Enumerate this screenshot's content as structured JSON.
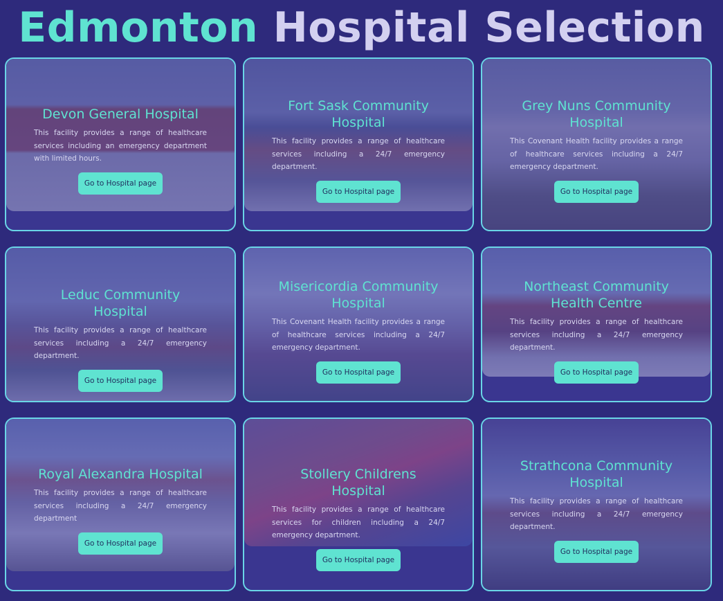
{
  "header": {
    "title_accent": "Edmonton",
    "title_rest": "Hospital Selection"
  },
  "hospitals": [
    {
      "name": "Devon General Hospital",
      "description": "This facility provides a range of healthcare services including an emergency department with limited hours.",
      "button_label": "Go to Hospital page"
    },
    {
      "name": "Fort Sask Community Hospital",
      "description": "This facility provides a range of healthcare services including a 24/7 emergency department.",
      "button_label": "Go to Hospital page"
    },
    {
      "name": "Grey Nuns Community Hospital",
      "description": "This Covenant Health facility provides a range of healthcare services including a 24/7 emergency department.",
      "button_label": "Go to Hospital page"
    },
    {
      "name": "Leduc Community Hospital",
      "description": "This facility provides a range of healthcare services including a 24/7 emergency department.",
      "button_label": "Go to Hospital page"
    },
    {
      "name": "Misericordia Community Hospital",
      "description": "This Covenant Health facility provides a range of healthcare services including a 24/7 emergency department.",
      "button_label": "Go to Hospital page"
    },
    {
      "name": "Northeast Community Health Centre",
      "description": "This facility provides a range of healthcare services including a 24/7 emergency department.",
      "button_label": "Go to Hospital page"
    },
    {
      "name": "Royal Alexandra Hospital",
      "description": "This facility provides a range of healthcare services including a 24/7 emergency department",
      "button_label": "Go to Hospital page"
    },
    {
      "name": "Stollery Childrens Hospital",
      "description": "This facility provides a range of healthcare services for children including a 24/7 emergency department.",
      "button_label": "Go to Hospital page"
    },
    {
      "name": "Strathcona Community Hospital",
      "description": "This facility provides a range of healthcare services including a 24/7 emergency department.",
      "button_label": "Go to Hospital page"
    }
  ],
  "colors": {
    "background": "#2e2a7c",
    "accent": "#5fe3d1",
    "card_border": "#6ad6e7",
    "title_secondary": "#d3d0f0"
  }
}
